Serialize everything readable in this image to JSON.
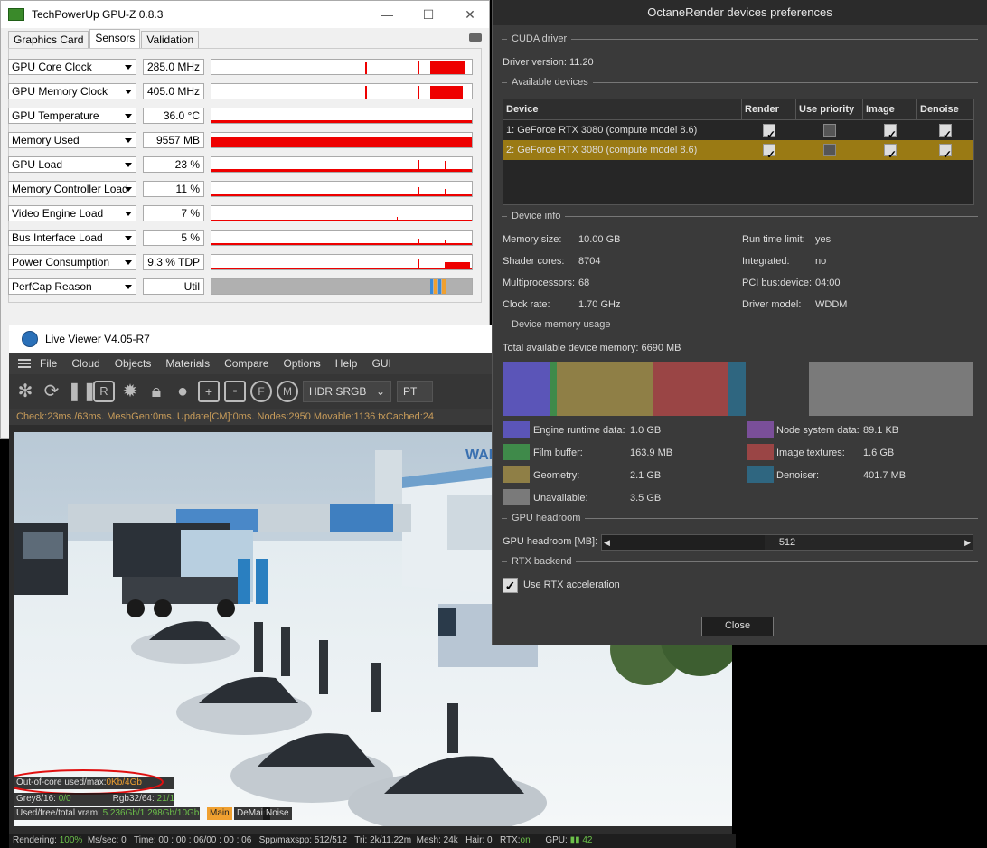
{
  "gpuz": {
    "title": "TechPowerUp GPU-Z 0.8.3",
    "tabs": [
      "Graphics Card",
      "Sensors",
      "Validation"
    ],
    "sensors": [
      {
        "name": "GPU Core Clock",
        "value": "285.0 MHz"
      },
      {
        "name": "GPU Memory Clock",
        "value": "405.0 MHz"
      },
      {
        "name": "GPU Temperature",
        "value": "36.0 °C"
      },
      {
        "name": "Memory Used",
        "value": "9557 MB"
      },
      {
        "name": "GPU Load",
        "value": "23 %"
      },
      {
        "name": "Memory Controller Load",
        "value": "11 %"
      },
      {
        "name": "Video Engine Load",
        "value": "7 %"
      },
      {
        "name": "Bus Interface Load",
        "value": "5 %"
      },
      {
        "name": "Power Consumption",
        "value": "9.3 % TDP"
      },
      {
        "name": "PerfCap Reason",
        "value": "Util"
      }
    ]
  },
  "liveviewer": {
    "title": "Live Viewer V4.05-R7",
    "menu": [
      "File",
      "Cloud",
      "Objects",
      "Materials",
      "Compare",
      "Options",
      "Help",
      "GUI"
    ],
    "colorspace": "HDR SRGB",
    "kernel": "PT",
    "status": "Check:23ms./63ms. MeshGen:0ms. Update[CM]:0ms. Nodes:2950 Movable:1136 txCached:24",
    "overlay": {
      "outofcore_label": "Out-of-core used/max:",
      "outofcore_value": "0Kb/4Gb",
      "grey_label": "Grey8/16:",
      "grey_value": "0/0",
      "rgb_label": "Rgb32/64:",
      "rgb_value": "21/1",
      "vram_label": "Used/free/total vram:",
      "vram_value": "5.236Gb/1.298Gb/10Gb",
      "tabs": [
        "Main",
        "DeMain",
        "Noise"
      ]
    },
    "stats": {
      "rendering_label": "Rendering:",
      "rendering_value": "100%",
      "mssec_label": "Ms/sec:",
      "mssec_value": "0",
      "time_label": "Time:",
      "time_value": "00 : 00 : 06/00 : 00 : 06",
      "spp_label": "Spp/maxspp:",
      "spp_value": "512/512",
      "tri_label": "Tri:",
      "tri_value": "2k/11.22m",
      "mesh_label": "Mesh:",
      "mesh_value": "24k",
      "hair_label": "Hair:",
      "hair_value": "0",
      "rtx_label": "RTX:",
      "rtx_value": "on",
      "gpu_label": "GPU:",
      "gpu_value": "42"
    },
    "sign_text": "WARE"
  },
  "octane": {
    "title": "OctaneRender devices preferences",
    "cuda_section": "CUDA driver",
    "driver_version_label": "Driver version:",
    "driver_version": "11.20",
    "devices_section": "Available devices",
    "table_headers": [
      "Device",
      "Render",
      "Use priority",
      "Image",
      "Denoise"
    ],
    "devices": [
      {
        "name": "1: GeForce RTX 3080 (compute model 8.6)",
        "render": true,
        "priority": false,
        "image": true,
        "denoise": true
      },
      {
        "name": "2: GeForce RTX 3080 (compute model 8.6)",
        "render": true,
        "priority": false,
        "image": true,
        "denoise": true
      }
    ],
    "info_section": "Device info",
    "info_left": [
      {
        "label": "Memory size:",
        "value": "10.00 GB"
      },
      {
        "label": "Shader cores:",
        "value": "8704"
      },
      {
        "label": "Multiprocessors:",
        "value": "68"
      },
      {
        "label": "Clock rate:",
        "value": "1.70 GHz"
      }
    ],
    "info_right": [
      {
        "label": "Run time limit:",
        "value": "yes"
      },
      {
        "label": "Integrated:",
        "value": "no"
      },
      {
        "label": "PCI bus:device:",
        "value": "04:00"
      },
      {
        "label": "Driver model:",
        "value": "WDDM"
      }
    ],
    "mem_section": "Device memory usage",
    "total_mem_label": "Total available device memory:",
    "total_mem_value": "6690 MB",
    "mem_legend_left": [
      {
        "label": "Engine runtime data:",
        "value": "1.0 GB",
        "color": "#5b55b8"
      },
      {
        "label": "Film buffer:",
        "value": "163.9 MB",
        "color": "#3f8a4a"
      },
      {
        "label": "Geometry:",
        "value": "2.1 GB",
        "color": "#8f7f46"
      },
      {
        "label": "Unavailable:",
        "value": "3.5 GB",
        "color": "#7a7a7a"
      }
    ],
    "mem_legend_right": [
      {
        "label": "Node system data:",
        "value": "89.1 KB",
        "color": "#7a4f99"
      },
      {
        "label": "Image textures:",
        "value": "1.6 GB",
        "color": "#9a4545"
      },
      {
        "label": "Denoiser:",
        "value": "401.7 MB",
        "color": "#2f6680"
      }
    ],
    "headroom_section": "GPU headroom",
    "headroom_label": "GPU headroom [MB]:",
    "headroom_value": "512",
    "rtx_section": "RTX backend",
    "rtx_label": "Use RTX acceleration",
    "close_label": "Close"
  }
}
